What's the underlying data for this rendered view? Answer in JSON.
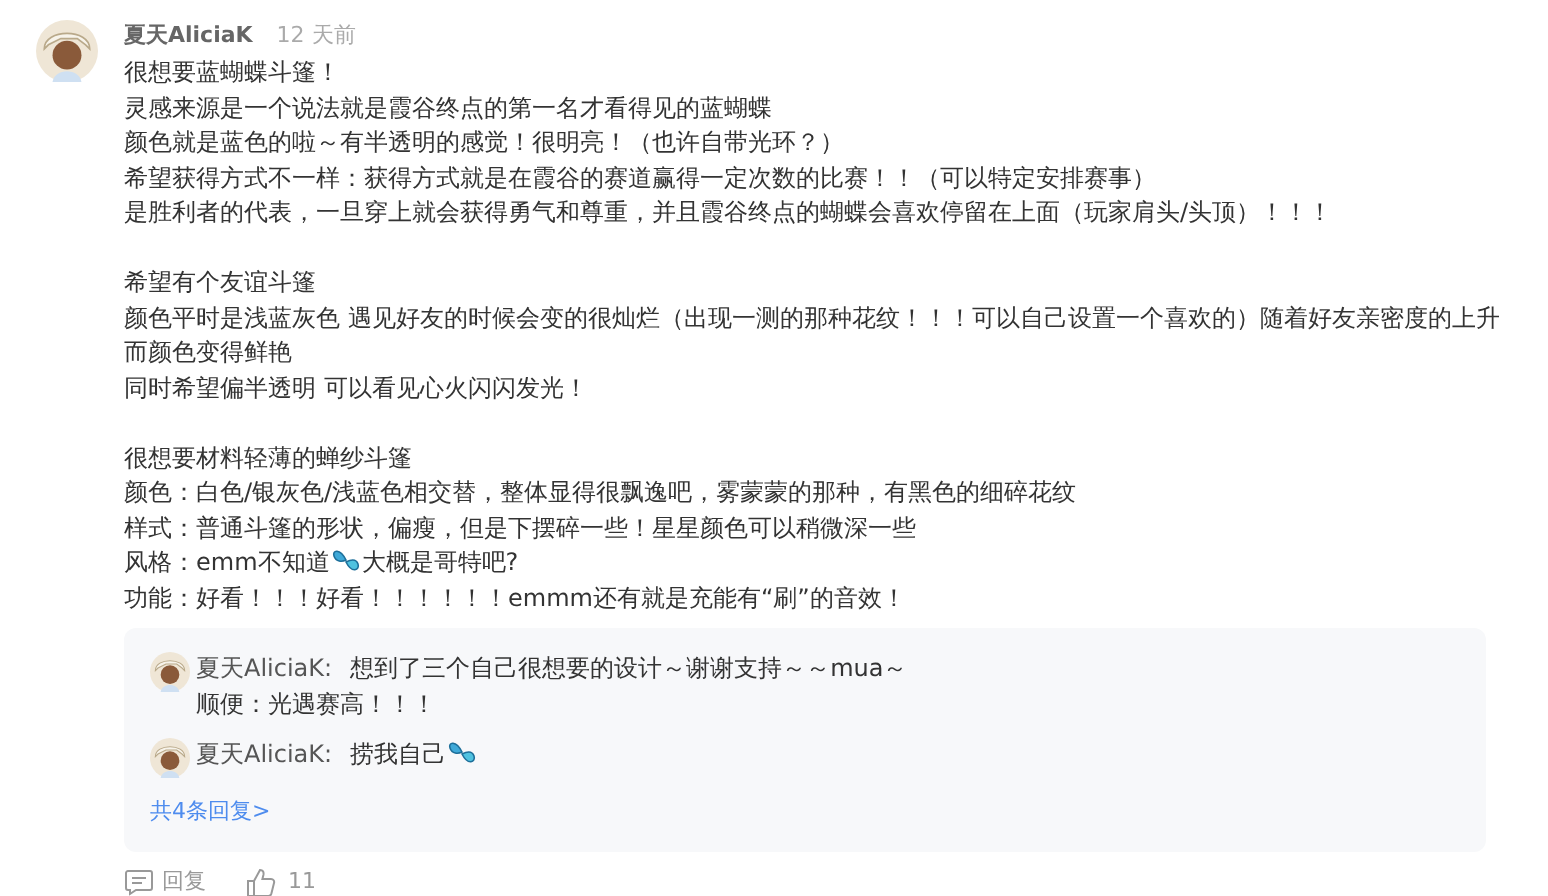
{
  "comment": {
    "author": "夏天AliciaK",
    "time": "12 天前",
    "paragraphs": [
      [
        [
          {
            "kind": "text",
            "text": "很想要蓝蝴蝶斗篷！"
          }
        ],
        [
          {
            "kind": "text",
            "text": "灵感来源是一个说法就是霞谷终点的第一名才看得见的蓝蝴蝶"
          }
        ],
        [
          {
            "kind": "text",
            "text": "颜色就是蓝色的啦～有半透明的感觉！很明亮！（也许自带光环？）"
          }
        ],
        [
          {
            "kind": "text",
            "text": "希望获得方式不一样：获得方式就是在霞谷的赛道赢得一定次数的比赛！！（可以特定安排赛事）"
          }
        ],
        [
          {
            "kind": "text",
            "text": "是胜利者的代表，一旦穿上就会获得勇气和尊重，并且霞谷终点的蝴蝶会喜欢停留在上面（玩家肩头/头顶）！！！"
          }
        ]
      ],
      [
        [
          {
            "kind": "text",
            "text": "希望有个友谊斗篷"
          }
        ],
        [
          {
            "kind": "text",
            "text": "颜色平时是浅蓝灰色 遇见好友的时候会变的很灿烂（出现一测的那种花纹！！！可以自己设置一个喜欢的）随着好友亲密度的上升而颜色变得鲜艳"
          }
        ],
        [
          {
            "kind": "text",
            "text": "同时希望偏半透明 可以看见心火闪闪发光！"
          }
        ]
      ],
      [
        [
          {
            "kind": "text",
            "text": "很想要材料轻薄的蝉纱斗篷"
          }
        ],
        [
          {
            "kind": "text",
            "text": "颜色：白色/银灰色/浅蓝色相交替，整体显得很飘逸吧，雾蒙蒙的那种，有黑色的细碎花纹"
          }
        ],
        [
          {
            "kind": "text",
            "text": "样式：普通斗篷的形状，偏瘦，但是下摆碎一些！星星颜色可以稍微深一些"
          }
        ],
        [
          {
            "kind": "text",
            "text": "风格：emm不知道"
          },
          {
            "kind": "emoji"
          },
          {
            "kind": "text",
            "text": "大概是哥特吧?"
          }
        ],
        [
          {
            "kind": "text",
            "text": "功能：好看！！！好看！！！！！！emmm还有就是充能有“刷”的音效！"
          }
        ]
      ]
    ]
  },
  "replies": [
    {
      "author": "夏天AliciaK:",
      "lines": [
        [
          {
            "kind": "text",
            "text": "想到了三个自己很想要的设计～谢谢支持～～mua～"
          }
        ],
        [
          {
            "kind": "text",
            "text": "顺便：光遇赛高！！！"
          }
        ]
      ]
    },
    {
      "author": "夏天AliciaK:",
      "lines": [
        [
          {
            "kind": "text",
            "text": "捞我自己"
          },
          {
            "kind": "emoji"
          }
        ]
      ]
    }
  ],
  "more_replies": "共4条回复>",
  "actions": {
    "reply": "回复",
    "likes": "11"
  }
}
